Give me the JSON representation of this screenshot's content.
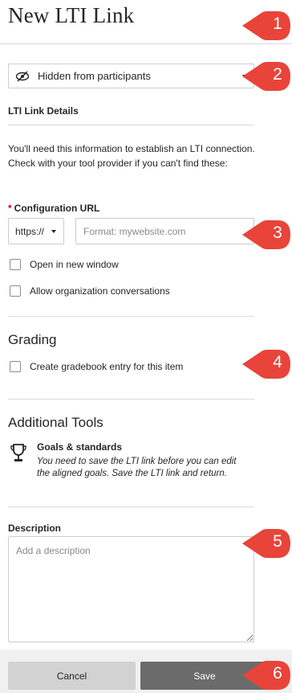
{
  "page": {
    "title": "New LTI Link"
  },
  "visibility": {
    "label": "Hidden from participants",
    "icon": "eye-slash-icon"
  },
  "lti_details": {
    "heading": "LTI Link Details",
    "help_text": "You'll need this information to establish an LTI connection. Check with your tool provider if you can't find these:",
    "required_marker": "*",
    "config_label": "Configuration URL",
    "protocol_value": "https://",
    "url_placeholder": "Format: mywebsite.com",
    "url_value": "",
    "open_new_window": "Open in new window",
    "allow_conversations": "Allow organization conversations"
  },
  "grading": {
    "heading": "Grading",
    "gradebook_label": "Create gradebook entry for this item"
  },
  "additional_tools": {
    "heading": "Additional Tools",
    "goals_title": "Goals & standards",
    "goals_text": "You need to save the LTI link before you can edit the aligned goals. Save the LTI link and return.",
    "goals_icon": "trophy-icon"
  },
  "description": {
    "label": "Description",
    "placeholder": "Add a description",
    "value": ""
  },
  "footer": {
    "cancel_label": "Cancel",
    "save_label": "Save"
  },
  "callouts": [
    "1",
    "2",
    "3",
    "4",
    "5",
    "6"
  ],
  "colors": {
    "callout": "#e8443a",
    "save_button": "#6b6b6b",
    "cancel_button": "#d2d2d2",
    "required": "#c9002f"
  }
}
